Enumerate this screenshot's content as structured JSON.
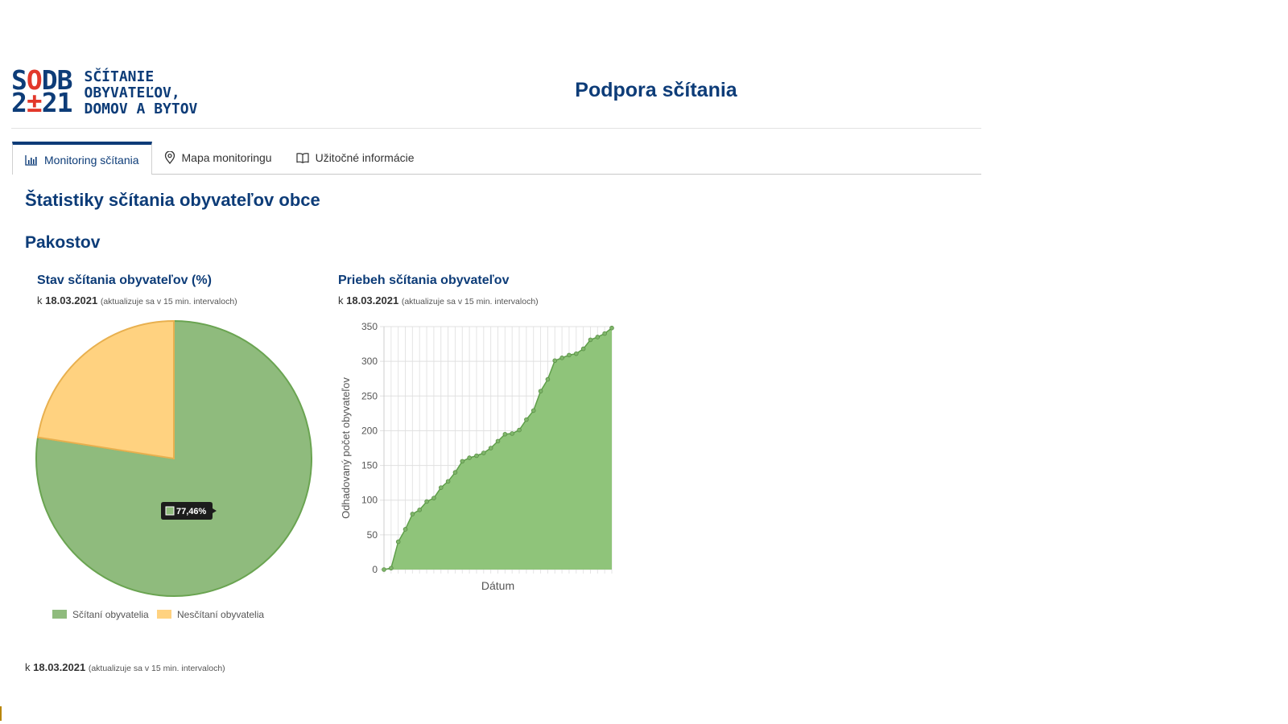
{
  "logo": {
    "mark_line1_a": "S",
    "mark_line1_b": "O",
    "mark_line1_c": "DB",
    "mark_line2_a": "2",
    "mark_line2_b": "±",
    "mark_line2_c": "21",
    "text_line1": "SČÍTANIE",
    "text_line2": "OBYVATEĽOV,",
    "text_line3": "DOMOV A BYTOV"
  },
  "header": {
    "title": "Podpora sčítania"
  },
  "tabs": [
    {
      "label": "Monitoring sčítania",
      "icon": "bar-chart-icon",
      "active": true
    },
    {
      "label": "Mapa monitoringu",
      "icon": "map-pin-icon",
      "active": false
    },
    {
      "label": "Užitočné informácie",
      "icon": "book-icon",
      "active": false
    }
  ],
  "page": {
    "heading": "Štatistiky sčítania obyvateľov obce",
    "place": "Pakostov"
  },
  "asof": {
    "prefix": "k",
    "date": "18.03.2021",
    "note": "(aktualizuje sa v 15 min. intervaloch)"
  },
  "colors": {
    "brand_blue": "#0d3c78",
    "brand_red": "#e2382b",
    "counted_fill": "#8fbb7d",
    "counted_border": "#6aa451",
    "uncounted_fill": "#ffd280",
    "uncounted_border": "#e8b04f",
    "area_fill": "#8fc47a",
    "area_line": "#5f9f4a"
  },
  "chart_data": [
    {
      "type": "pie",
      "title": "Stav sčítania obyvateľov (%)",
      "slices": [
        {
          "name": "Sčítaní obyvatelia",
          "value": 77.46
        },
        {
          "name": "Nesčítaní obyvatelia",
          "value": 22.54
        }
      ],
      "tooltip": "77,46%",
      "legend": "bottom"
    },
    {
      "type": "area",
      "title": "Priebeh sčítania obyvateľov",
      "xlabel": "Dátum",
      "ylabel": "Odhadovaný počet obyvateľov",
      "ylim": [
        0,
        350
      ],
      "yticks": [
        0,
        50,
        100,
        150,
        200,
        250,
        300,
        350
      ],
      "grid": true,
      "values": [
        0,
        2,
        40,
        58,
        80,
        86,
        98,
        103,
        118,
        127,
        140,
        156,
        161,
        164,
        168,
        175,
        185,
        195,
        196,
        201,
        216,
        229,
        257,
        274,
        301,
        305,
        309,
        311,
        318,
        331,
        335,
        340,
        348
      ]
    }
  ]
}
